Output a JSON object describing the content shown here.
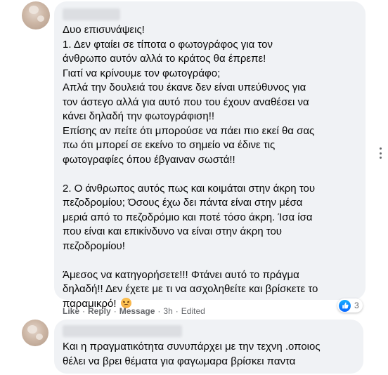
{
  "comment_1": {
    "text_lines": [
      "Δυο επισυνάψεις!",
      "1. Δεν φταίει σε τίποτα ο φωτογράφος για τον",
      "άνθρωπο αυτόν αλλά το κράτος θα έπρεπε!",
      "Γιατί να κρίνουμε τον φωτογράφο;",
      "Απλά την δουλειά του έκανε δεν είναι υπεύθυνος για",
      "τον άστεγο αλλά για αυτό που του έχουν αναθέσει να",
      "κάνει δηλαδή την φωτογράφιση!!",
      "Επίσης αν πείτε ότι μπορούσε να πάει πιο εκεί θα σας",
      "πω ότι μπορεί σε εκείνο το σημείο να έδινε τις",
      "φωτογραφίες όπου έβγαιναν σωστά!!",
      "",
      "2. Ο άνθρωπος αυτός πως και κοιμάται στην άκρη του",
      "πεζοδρομίου; Όσους έχω δει πάντα είναι στην μέσα",
      "μεριά από το πεζοδρόμιο και ποτέ τόσο άκρη. Ίσα ίσα",
      "που είναι και επικίνδυνο να είναι στην άκρη του",
      "πεζοδρομίου!",
      "",
      "Άμεσος να κατηγορήσετε!!! Φτάνει αυτό το πράγμα",
      "δηλαδή!! Δεν έχετε με τι να ασχοληθείτε και βρίσκετε το",
      "παραμικρό!"
    ],
    "emoji": "angry-face",
    "actions": {
      "like": "Like",
      "reply": "Reply",
      "message": "Message",
      "time": "3h",
      "edited": "Edited",
      "separator": "·"
    },
    "reactions": {
      "icon": "like-icon",
      "count": "3"
    }
  },
  "comment_2": {
    "text_lines": [
      "Και η πραγματικότητα συνυπάρχει με την τεχνη .οποιος",
      "θέλει να βρει θέματα για φαγωμαρα βρίσκει παντα"
    ]
  },
  "colors": {
    "bubble": "#f0f2f5",
    "meta_text": "#65676b",
    "like_blue": "#0866ff"
  }
}
